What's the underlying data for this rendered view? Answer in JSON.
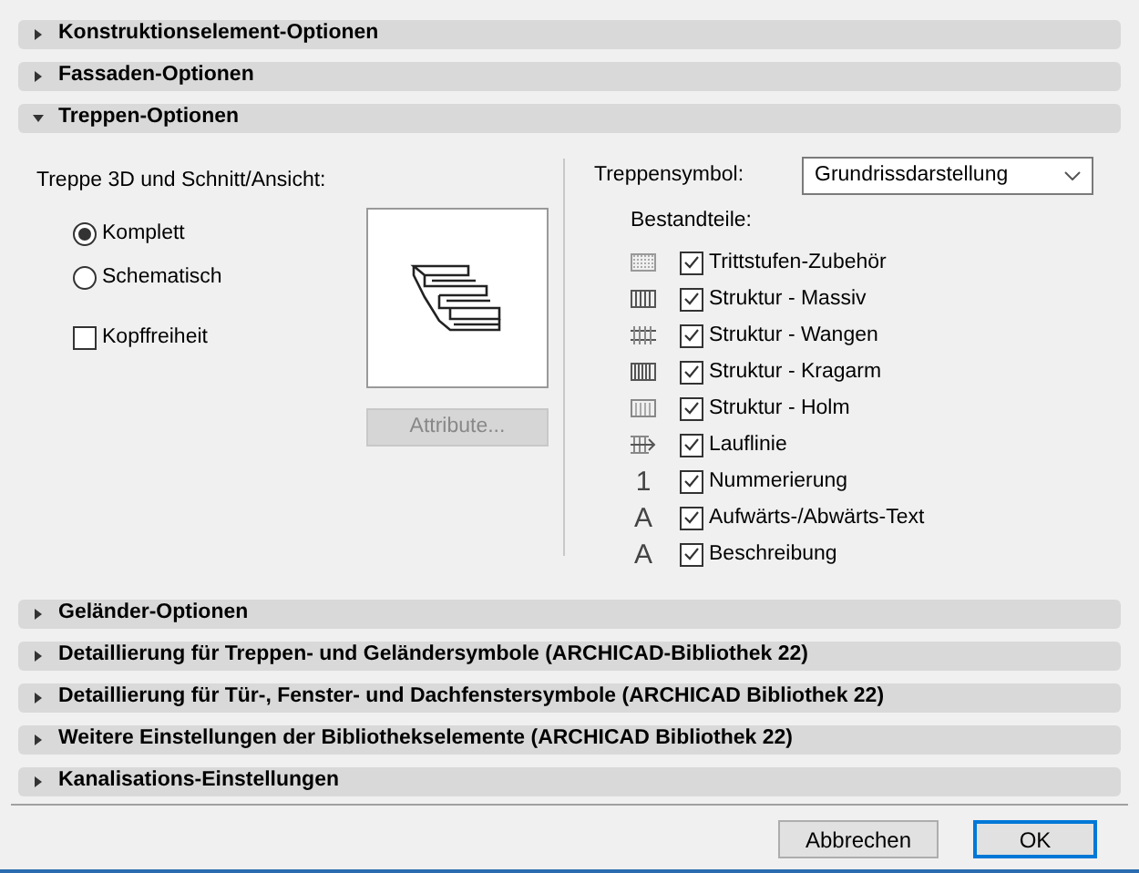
{
  "sections_top": [
    {
      "title": "Konstruktionselement-Optionen",
      "expanded": false
    },
    {
      "title": "Fassaden-Optionen",
      "expanded": false
    },
    {
      "title": "Treppen-Optionen",
      "expanded": true
    }
  ],
  "stair_3d": {
    "label": "Treppe 3D und Schnitt/Ansicht:",
    "options": [
      {
        "label": "Komplett",
        "selected": true
      },
      {
        "label": "Schematisch",
        "selected": false
      }
    ],
    "headroom": {
      "label": "Kopffreiheit",
      "checked": false
    },
    "attribute_button": {
      "label": "Attribute...",
      "disabled": true
    }
  },
  "stair_symbol": {
    "label": "Treppensymbol:",
    "value": "Grundrissdarstellung",
    "components_label": "Bestandteile:",
    "components": [
      {
        "kind": "dotted",
        "label": "Trittstufen-Zubehör",
        "checked": true
      },
      {
        "kind": "bars",
        "label": "Struktur - Massiv",
        "checked": true
      },
      {
        "kind": "rails",
        "label": "Struktur - Wangen",
        "checked": true
      },
      {
        "kind": "dense",
        "label": "Struktur - Kragarm",
        "checked": true
      },
      {
        "kind": "frame",
        "label": "Struktur - Holm",
        "checked": true
      },
      {
        "kind": "arrow",
        "label": "Lauflinie",
        "checked": true
      },
      {
        "kind": "glyph",
        "glyph": "1",
        "label": "Nummerierung",
        "checked": true
      },
      {
        "kind": "glyph",
        "glyph": "A",
        "label": "Aufwärts-/Abwärts-Text",
        "checked": true
      },
      {
        "kind": "glyph",
        "glyph": "A",
        "label": "Beschreibung",
        "checked": true
      }
    ]
  },
  "sections_bottom": [
    {
      "title": "Geländer-Optionen",
      "expanded": false
    },
    {
      "title": "Detaillierung für Treppen- und Geländersymbole (ARCHICAD-Bibliothek 22)",
      "expanded": false
    },
    {
      "title": "Detaillierung für Tür-, Fenster- und Dachfenstersymbole (ARCHICAD Bibliothek 22)",
      "expanded": false
    },
    {
      "title": "Weitere Einstellungen der Bibliothekselemente (ARCHICAD Bibliothek 22)",
      "expanded": false
    },
    {
      "title": "Kanalisations-Einstellungen",
      "expanded": false
    }
  ],
  "buttons": [
    {
      "label": "Abbrechen",
      "default": false
    },
    {
      "label": "OK",
      "default": true
    }
  ]
}
